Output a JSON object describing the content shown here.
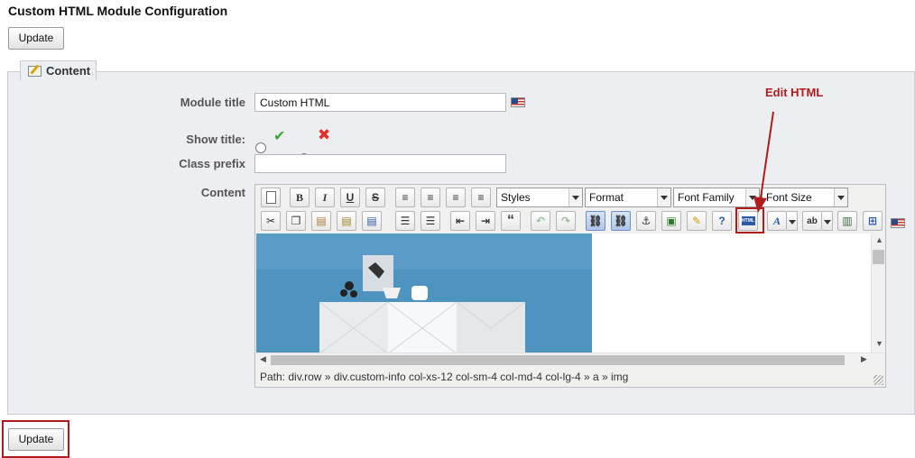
{
  "page": {
    "title": "Custom HTML Module Configuration"
  },
  "buttons": {
    "update_top": "Update",
    "update_bottom": "Update"
  },
  "fieldset": {
    "legend": "Content",
    "legend_icon": "edit-icon"
  },
  "form": {
    "module_title_label": "Module title",
    "module_title_value": "Custom HTML",
    "show_title_label": "Show title:",
    "show_title_selected": "no",
    "class_prefix_label": "Class prefix",
    "class_prefix_value": "",
    "content_label": "Content"
  },
  "editor": {
    "selects": {
      "styles": "Styles",
      "format": "Format",
      "font_family": "Font Family",
      "font_size": "Font Size"
    },
    "toolbar_row1": [
      "new-document",
      "bold",
      "italic",
      "underline",
      "strikethrough",
      "align-left",
      "align-center",
      "align-right",
      "align-justify"
    ],
    "toolbar_row2": [
      "cut",
      "copy",
      "paste",
      "paste-text",
      "paste-word",
      "bullet-list",
      "numbered-list",
      "outdent",
      "indent",
      "blockquote",
      "undo",
      "redo",
      "link",
      "unlink",
      "anchor",
      "image",
      "cleanup",
      "help",
      "html",
      "text-color",
      "highlight-color",
      "media",
      "table"
    ],
    "path": "Path: div.row » div.custom-info col-xs-12 col-sm-4 col-md-4 col-lg-4 » a » img"
  },
  "annotation": {
    "label": "Edit HTML",
    "color": "#b01c1c"
  },
  "colors": {
    "fieldset_bg": "#eceef1",
    "image_sky": "#4f93c0",
    "toolbar_bg": "#f0f0ee"
  }
}
